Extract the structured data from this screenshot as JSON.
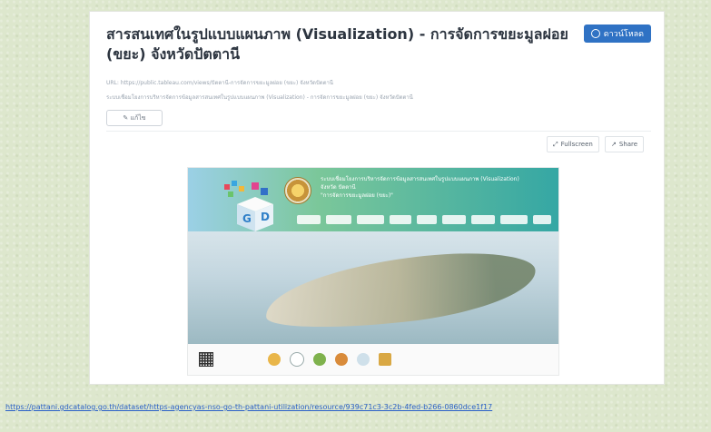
{
  "page": {
    "title": "สารสนเทศในรูปแบบแผนภาพ (Visualization) - การจัดการขยะมูลฝอย (ขยะ) จังหวัดปัตตานี",
    "download_label": "ดาวน์โหลด",
    "url_line": "URL: https://public.tableau.com/views/ปัตตานี-การจัดการขยะมูลฝอย (ขยะ) จังหวัดปัตตานี",
    "description_line": "ระบบเชื่อมโยงการบริหารจัดการข้อมูลสารสนเทศในรูปแบบแผนภาพ (Visualization) - การจัดการขยะมูลฝอย (ขยะ) จังหวัดปัตตานี",
    "edit_label": "✎ แก้ไข",
    "fullscreen_label": "Fullscreen",
    "share_label": "Share"
  },
  "viz": {
    "banner_title": "ระบบเชื่อมโยงการบริหารจัดการข้อมูลสารสนเทศในรูปแบบแผนภาพ (Visualization)",
    "banner_province": "จังหวัด ปัตตานี",
    "banner_topic": "\"การจัดการขยะมูลฝอย (ขยะ)\"",
    "cube_letters": [
      "G",
      "D"
    ],
    "footer_logos": [
      "qr-code",
      "provincial-seal",
      "nso-logo",
      "agency-logo",
      "agency-logo-2",
      "gdcatalog-logo",
      "garuda-emblem"
    ]
  },
  "source_url": "https://pattani.gdcatalog.go.th/dataset/https-agencyas-nso-go-th-pattani-utilization/resource/939c71c3-3c2b-4fed-b266-0860dce1f17",
  "colors": {
    "background": "#dde7cd",
    "accent": "#2f72c4",
    "link": "#2b61c7"
  }
}
